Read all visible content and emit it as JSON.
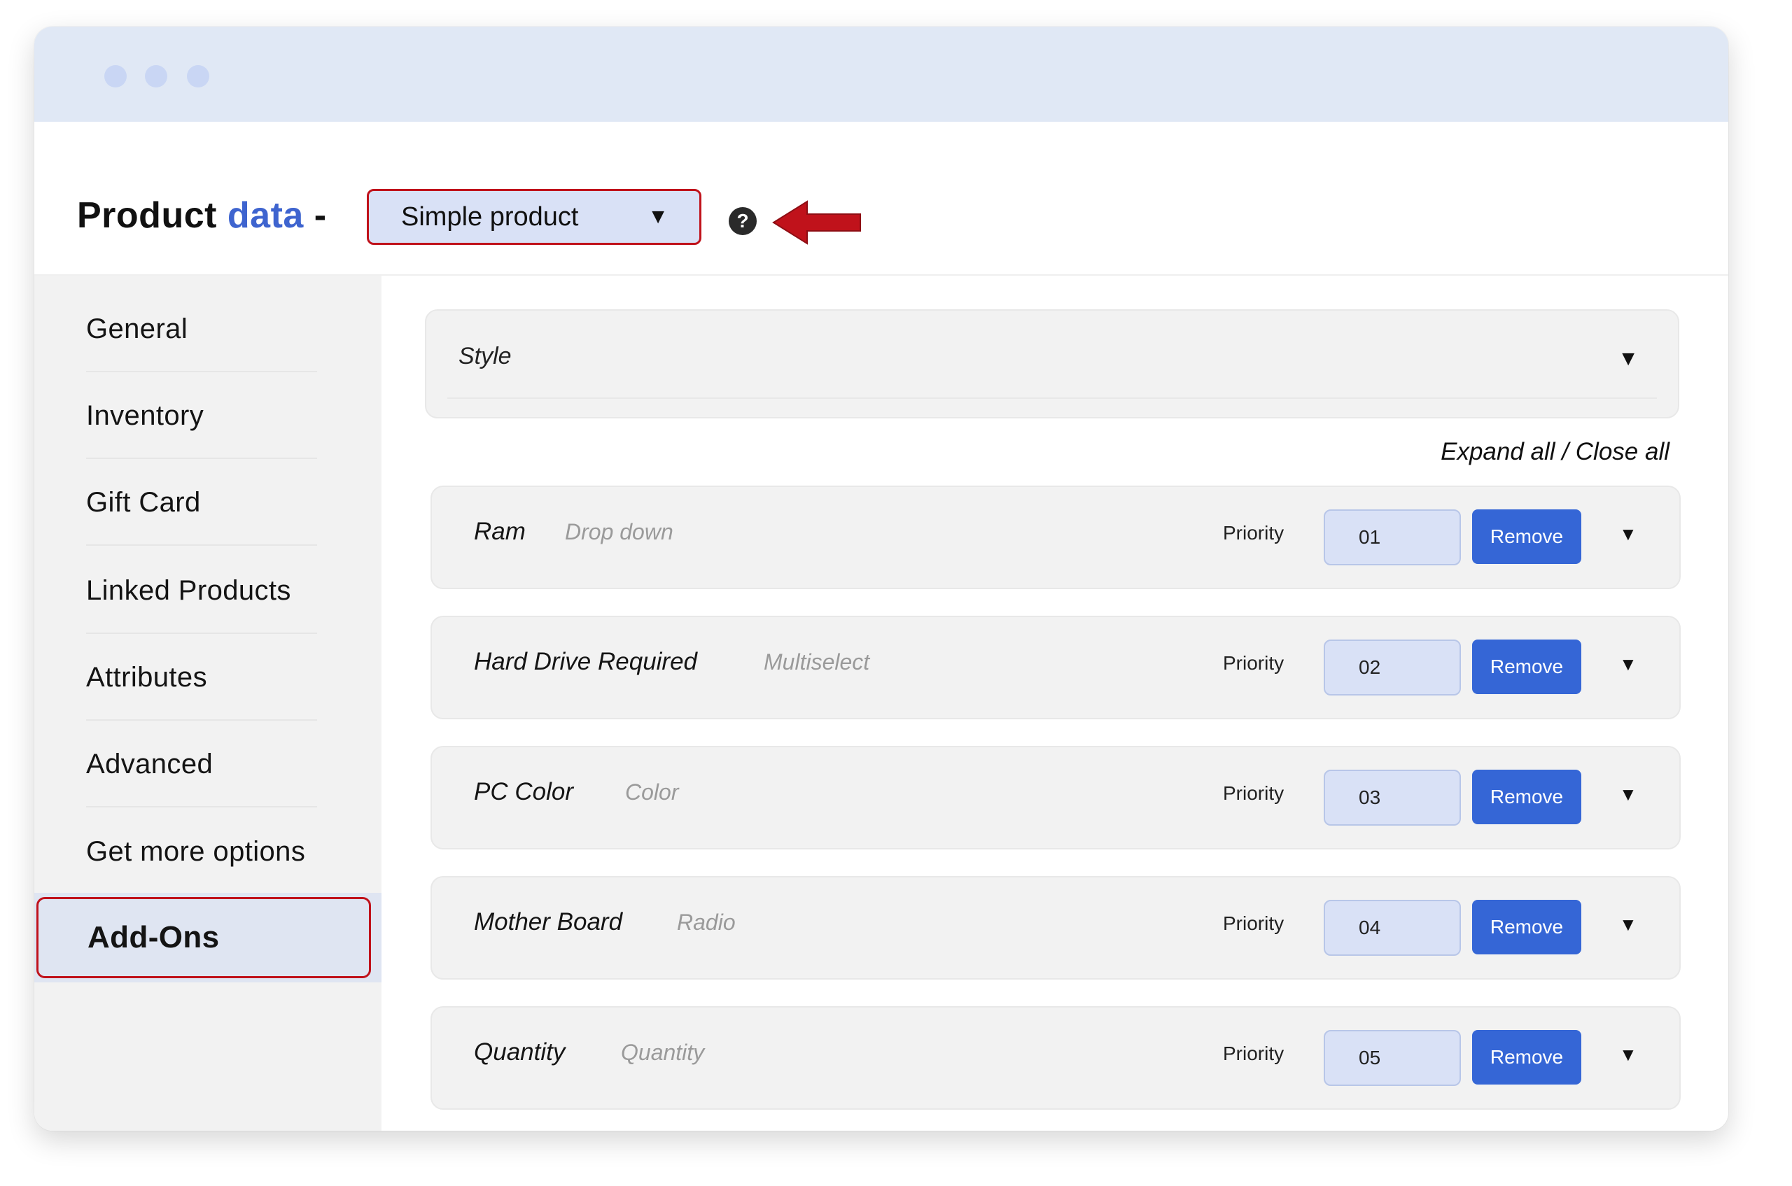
{
  "header": {
    "title_main": "Product",
    "title_accent": "data",
    "title_sep": "-",
    "product_type": "Simple product",
    "help_symbol": "?"
  },
  "sidebar": {
    "items": [
      {
        "label": "General"
      },
      {
        "label": "Inventory"
      },
      {
        "label": "Gift Card"
      },
      {
        "label": "Linked Products"
      },
      {
        "label": "Attributes"
      },
      {
        "label": "Advanced"
      },
      {
        "label": "Get more options"
      }
    ],
    "active_label": "Add-Ons"
  },
  "main": {
    "style_label": "Style",
    "expand_all": "Expand all",
    "separator": "/",
    "close_all": "Close all",
    "addons": [
      {
        "name": "Ram",
        "type": "Drop down",
        "priority_label": "Priority",
        "priority": "01",
        "remove_label": "Remove"
      },
      {
        "name": "Hard Drive Required",
        "type": "Multiselect",
        "priority_label": "Priority",
        "priority": "02",
        "remove_label": "Remove"
      },
      {
        "name": "PC Color",
        "type": "Color",
        "priority_label": "Priority",
        "priority": "03",
        "remove_label": "Remove"
      },
      {
        "name": "Mother Board",
        "type": "Radio",
        "priority_label": "Priority",
        "priority": "04",
        "remove_label": "Remove"
      },
      {
        "name": "Quantity",
        "type": "Quantity",
        "priority_label": "Priority",
        "priority": "05",
        "remove_label": "Remove"
      }
    ]
  },
  "colors": {
    "accent": "#3e64cf",
    "highlight": "#c0121b",
    "button": "#3566d6",
    "titlebar": "#e0e8f5"
  }
}
